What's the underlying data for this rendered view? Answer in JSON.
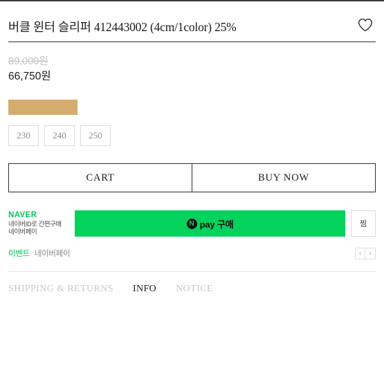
{
  "product": {
    "title": "버클 윈터 슬리퍼 412443002 (4cm/1color)  25%",
    "wishlist_icon": "heart-icon"
  },
  "price": {
    "original": "89,000원",
    "sale": "66,750원"
  },
  "options": {
    "color_swatch": {
      "name": "beige",
      "hex": "#d4ad6e"
    },
    "sizes": [
      {
        "label": "230"
      },
      {
        "label": "240"
      },
      {
        "label": "250"
      }
    ]
  },
  "actions": {
    "cart_label": "CART",
    "buy_now_label": "BUY NOW"
  },
  "naver": {
    "logo": "NAVER",
    "sub_line1": "네이버ID로 간편구매",
    "sub_line2": "네이버페이",
    "pay_mark": "N",
    "pay_label": "pay 구매",
    "wishlist_label": "찜",
    "brand_hex": "#03c75a",
    "button_hex": "#03d35c"
  },
  "event": {
    "tag": "이벤트",
    "text": "네이버페이",
    "prev_icon": "chevron-left-icon",
    "next_icon": "chevron-right-icon",
    "prev_glyph": "‹",
    "next_glyph": "›"
  },
  "tabs": [
    {
      "label": "SHIPPING & RETURNS",
      "active": false
    },
    {
      "label": "INFO",
      "active": true
    },
    {
      "label": "NOTICE",
      "active": false
    }
  ]
}
